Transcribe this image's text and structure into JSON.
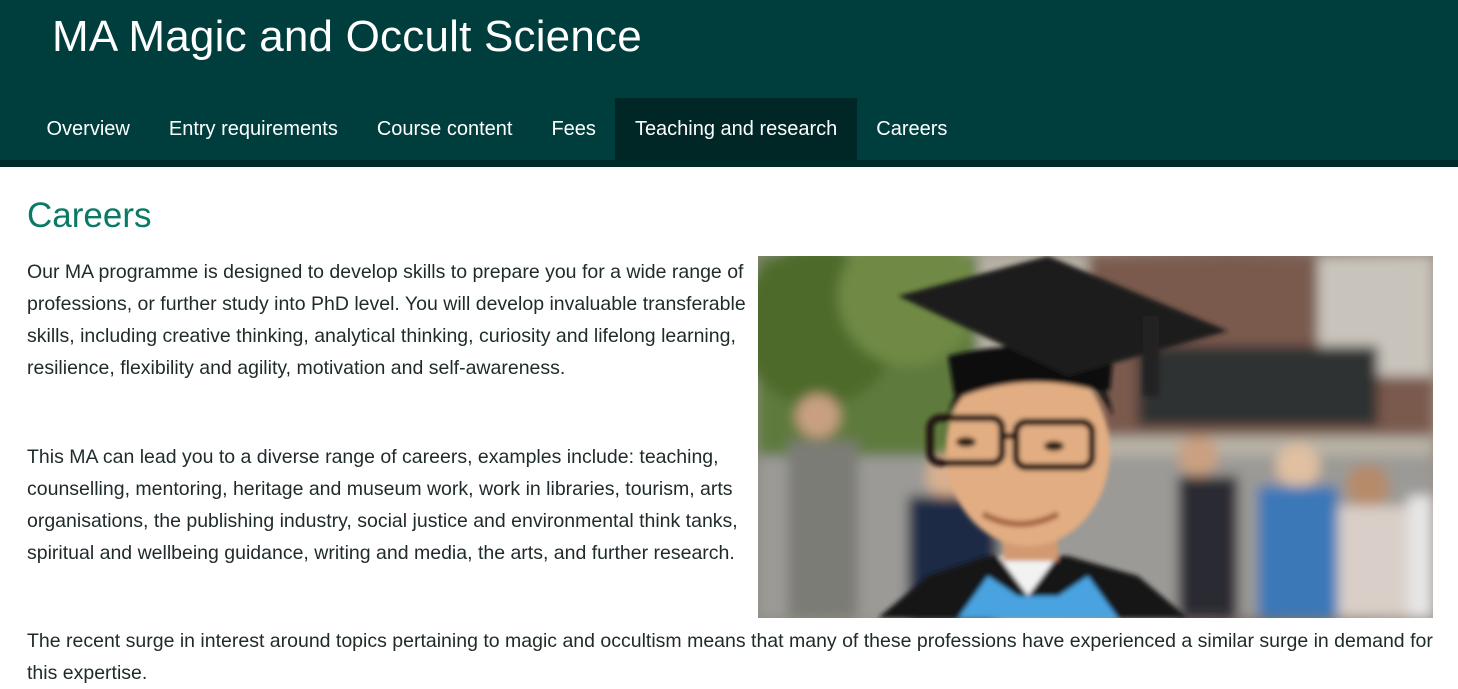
{
  "header": {
    "title": "MA Magic and Occult Science"
  },
  "nav": {
    "items": [
      {
        "label": "Overview"
      },
      {
        "label": "Entry requirements"
      },
      {
        "label": "Course content"
      },
      {
        "label": "Fees"
      },
      {
        "label": "Teaching and research"
      },
      {
        "label": "Careers"
      }
    ],
    "active_index": 4
  },
  "main": {
    "heading": "Careers",
    "paragraphs": [
      "Our MA programme is designed to develop skills to prepare you for a wide range of professions, or further study into PhD level.  You will develop invaluable transferable skills, including creative thinking, analytical thinking, curiosity and lifelong learning, resilience, flexibility and agility, motivation and self-awareness.",
      "This MA can lead you to a diverse range of careers, examples include: teaching, counselling, mentoring, heritage and museum work, work in libraries, tourism, arts organisations, the publishing industry, social justice and environmental think tanks, spiritual and wellbeing guidance, writing and media, the arts, and further research.",
      "The recent surge in interest around topics pertaining to magic and occultism means that many of these professions have experienced a similar surge in demand for this expertise."
    ]
  },
  "colors": {
    "header_bg": "#003d3d",
    "active_tab_bg": "#002626",
    "heading": "#0a7a66",
    "body_text": "#1f2a2a"
  }
}
